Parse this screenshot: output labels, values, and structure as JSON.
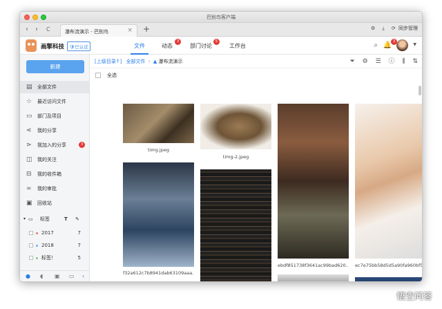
{
  "window": {
    "title": "巴别鸟客户端"
  },
  "browser": {
    "tab_title": "瀑布流演示 - 巴别鸟",
    "tab_close": "×",
    "new_tab": "+",
    "back": "‹",
    "forward": "›",
    "reload": "C",
    "settings_icon": "gear-icon",
    "download_icon": "download-icon",
    "sync_label": "同步管理"
  },
  "header": {
    "company": "画擎科技",
    "verified": "已认证",
    "tabs": [
      {
        "label": "文件",
        "badge": ""
      },
      {
        "label": "动态",
        "badge": "3"
      },
      {
        "label": "部门讨论",
        "badge": "5"
      },
      {
        "label": "工作台",
        "badge": ""
      }
    ],
    "notify_badge": "3"
  },
  "sidebar": {
    "new_button": "新建",
    "items": [
      {
        "label": "全部文件",
        "icon": "file-icon",
        "badge": ""
      },
      {
        "label": "最近访问文件",
        "icon": "star-icon",
        "badge": ""
      },
      {
        "label": "部门及项目",
        "icon": "folder-icon",
        "badge": ""
      },
      {
        "label": "我的分享",
        "icon": "share-icon",
        "badge": ""
      },
      {
        "label": "我加入的分享",
        "icon": "shared-join-icon",
        "badge": "3"
      },
      {
        "label": "我的关注",
        "icon": "follow-icon",
        "badge": ""
      },
      {
        "label": "我的收件箱",
        "icon": "inbox-icon",
        "badge": ""
      },
      {
        "label": "我的审批",
        "icon": "approval-icon",
        "badge": ""
      },
      {
        "label": "回收站",
        "icon": "trash-icon",
        "badge": ""
      }
    ],
    "tags_label": "标签",
    "tags": [
      {
        "label": "2017",
        "count": "7",
        "color": "#e57373"
      },
      {
        "label": "2018",
        "count": "7",
        "color": "#64b5f6"
      },
      {
        "label": "标签！",
        "count": "5",
        "color": "#81c784"
      }
    ]
  },
  "breadcrumb": {
    "up": "[上级目录↑]",
    "root": "全部文件",
    "sep": "›",
    "current": "瀑布流演示"
  },
  "toolbar": {
    "select_all": "全选"
  },
  "files": [
    {
      "name": "timg.jpeg"
    },
    {
      "name": "timg-2.jpeg"
    },
    {
      "name": "ebdf851738f3641ac99bad620..."
    },
    {
      "name": "ec7e75bb58d5d5a90fa960bf5..."
    },
    {
      "name": "f32a612c7b8941dab63109aaa..."
    },
    {
      "name": ""
    }
  ],
  "watermark": "悟空问答",
  "colors": {
    "accent": "#2b7de9",
    "new_button": "#5aa3ee",
    "badge": "#e53935"
  }
}
